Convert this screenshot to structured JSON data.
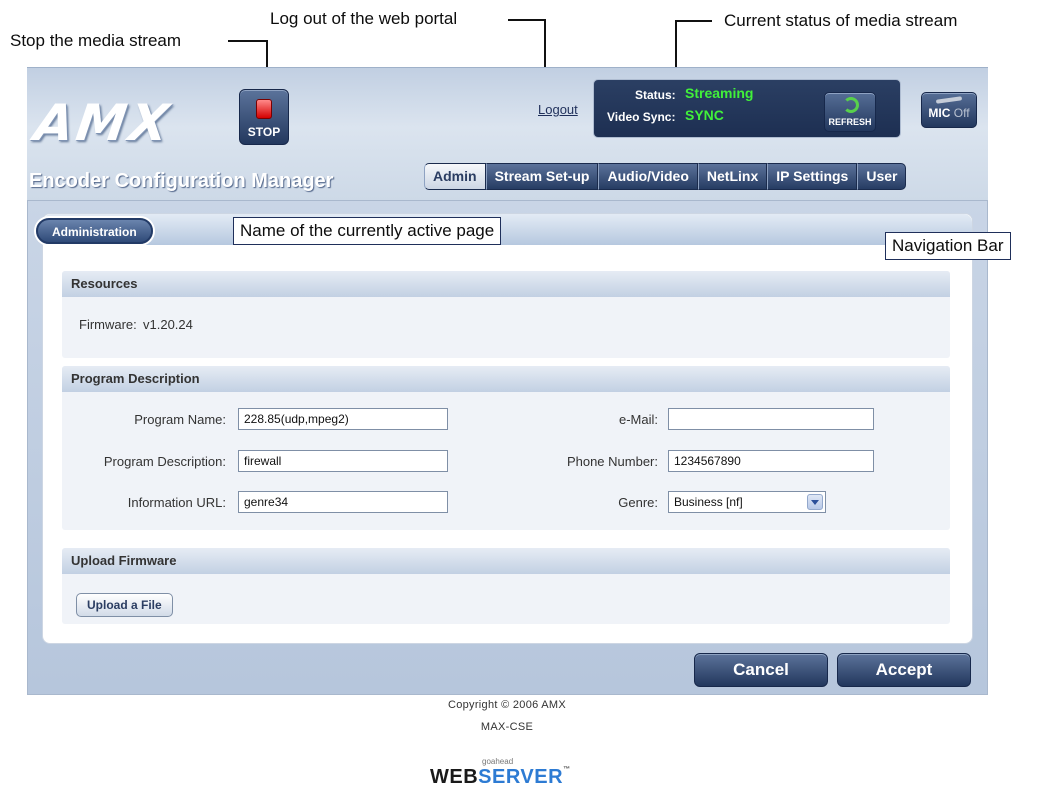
{
  "callouts": {
    "stop_stream": "Stop the media stream",
    "logout": "Log out of the web portal",
    "current_status": "Current status of media stream",
    "active_page": "Name of the currently active page",
    "navigation_bar": "Navigation Bar"
  },
  "header": {
    "logo": "AMX",
    "stop_label": "STOP",
    "logout_label": "Logout",
    "status_label": "Status:",
    "status_value": "Streaming",
    "video_sync_label": "Video Sync:",
    "video_sync_value": "SYNC",
    "refresh_label": "REFRESH",
    "mic_label": "MIC",
    "mic_state": "Off",
    "app_title": "Encoder Configuration Manager",
    "status_value_color": "#41f03a"
  },
  "nav": {
    "tabs": [
      {
        "label": "Admin",
        "active": true
      },
      {
        "label": "Stream Set-up",
        "active": false
      },
      {
        "label": "Audio/Video",
        "active": false
      },
      {
        "label": "NetLinx",
        "active": false
      },
      {
        "label": "IP Settings",
        "active": false
      },
      {
        "label": "User",
        "active": false
      }
    ]
  },
  "page": {
    "active_page_name": "Administration"
  },
  "resources": {
    "heading": "Resources",
    "firmware_label": "Firmware:",
    "firmware_value": "v1.20.24"
  },
  "program": {
    "heading": "Program Description",
    "program_name_label": "Program Name:",
    "program_name_value": "228.85(udp,mpeg2)",
    "program_description_label": "Program Description:",
    "program_description_value": "firewall",
    "information_url_label": "Information URL:",
    "information_url_value": "genre34",
    "email_label": "e-Mail:",
    "email_value": "",
    "phone_label": "Phone Number:",
    "phone_value": "1234567890",
    "genre_label": "Genre:",
    "genre_value": "Business [nf]"
  },
  "upload": {
    "heading": "Upload Firmware",
    "button_label": "Upload a File"
  },
  "actions": {
    "cancel_label": "Cancel",
    "accept_label": "Accept"
  },
  "footer": {
    "copyright": "Copyright © 2006 AMX",
    "model": "MAX-CSE",
    "server_small": "goahead",
    "server_word_1": "WEB",
    "server_word_2": "SERVER",
    "server_tm": "™"
  }
}
